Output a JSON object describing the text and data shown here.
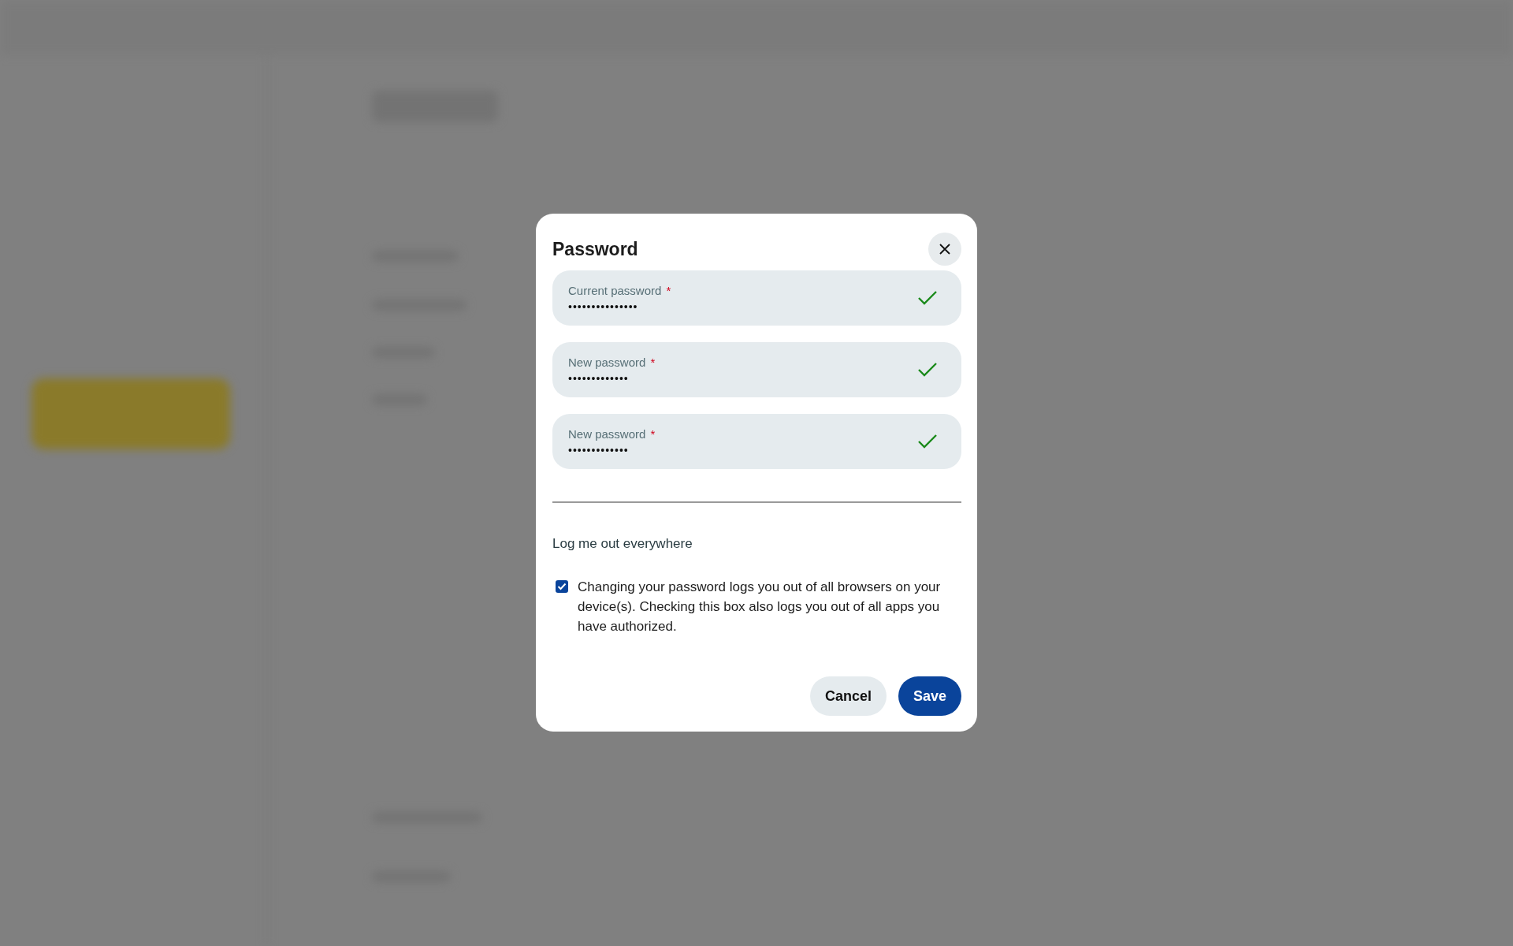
{
  "dialog": {
    "title": "Password",
    "fields": [
      {
        "label": "Current password",
        "required_mark": "*",
        "value": "•••••••••••••••",
        "valid": true
      },
      {
        "label": "New password",
        "required_mark": "*",
        "value": "•••••••••••••",
        "valid": true
      },
      {
        "label": "New password",
        "required_mark": "*",
        "value": "•••••••••••••",
        "valid": true
      }
    ],
    "section_title": "Log me out everywhere",
    "logout_option": {
      "checked": true,
      "text": "Changing your password logs you out of all browsers on your device(s). Checking this box also logs you out of all apps you have authorized."
    },
    "buttons": [
      {
        "label": "Cancel",
        "kind": "secondary"
      },
      {
        "label": "Save",
        "kind": "primary"
      }
    ]
  }
}
